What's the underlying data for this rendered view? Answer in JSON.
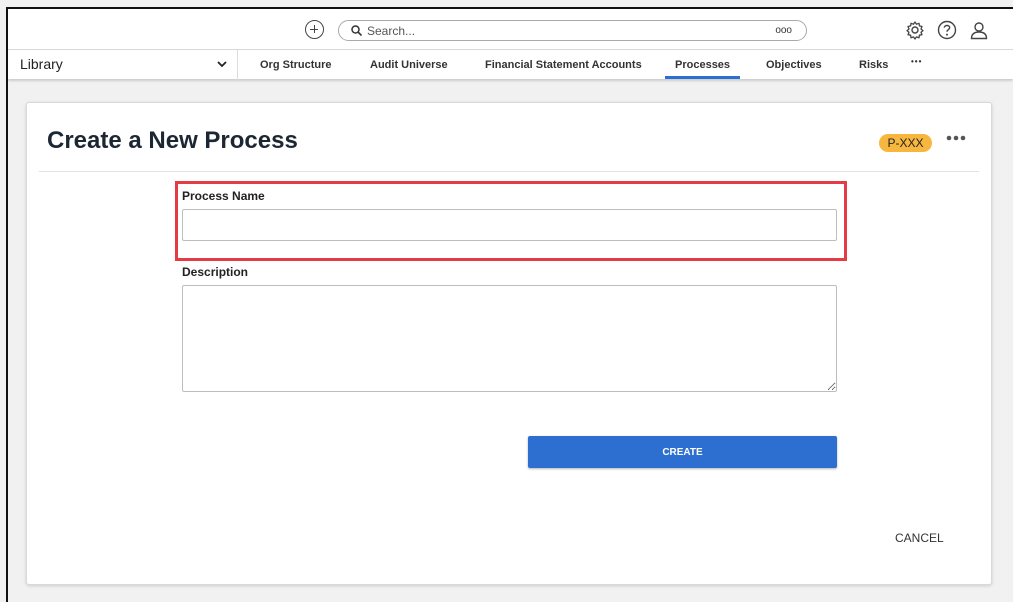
{
  "topbar": {
    "search_placeholder": "Search...",
    "search_options": "ooo"
  },
  "navbar": {
    "library": "Library",
    "tabs": [
      {
        "label": "Org Structure"
      },
      {
        "label": "Audit Universe"
      },
      {
        "label": "Financial Statement Accounts"
      },
      {
        "label": "Processes",
        "active": true
      },
      {
        "label": "Objectives"
      },
      {
        "label": "Risks"
      },
      {
        "label": "•••"
      }
    ]
  },
  "form": {
    "title": "Create a New Process",
    "id_badge": "P-XXX",
    "process_name_label": "Process Name",
    "process_name_value": "",
    "description_label": "Description",
    "description_value": "",
    "create_label": "CREATE",
    "cancel_label": "CANCEL"
  },
  "colors": {
    "primary": "#2d6fd0",
    "badge": "#f7b63e",
    "highlight": "#e53b45"
  }
}
